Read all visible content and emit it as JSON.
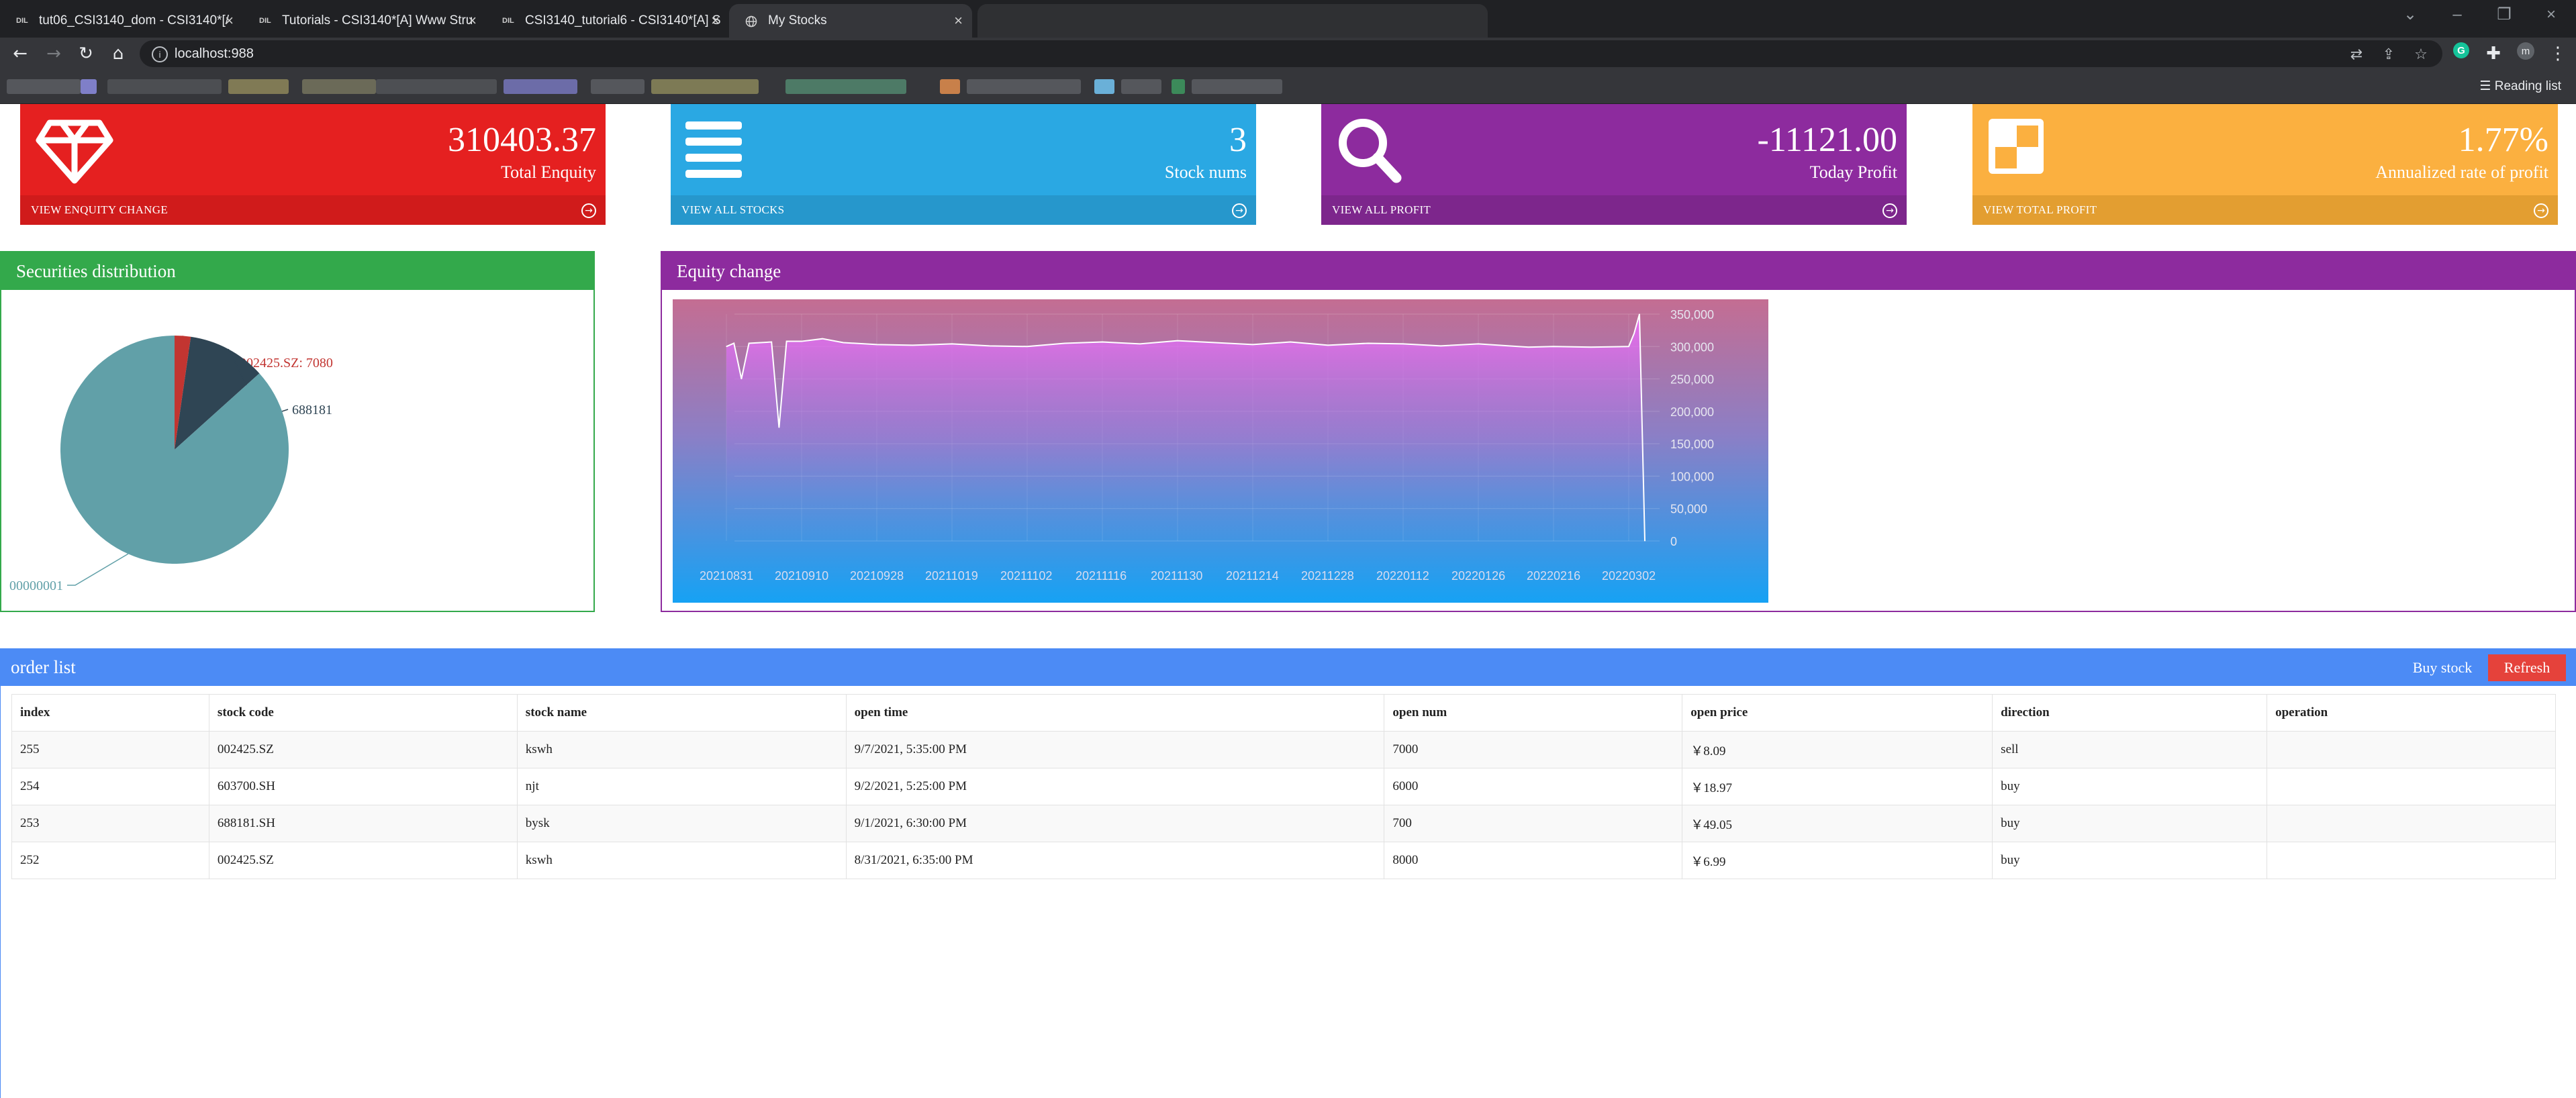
{
  "browser": {
    "tabs": [
      {
        "favicon": "DIL",
        "title": "tut06_CSI3140_dom - CSI3140*[/"
      },
      {
        "favicon": "DIL",
        "title": "Tutorials - CSI3140*[A] Www Stru"
      },
      {
        "favicon": "DIL",
        "title": "CSI3140_tutorial6 - CSI3140*[A] S"
      },
      {
        "favicon": "globe-icon",
        "title": "My Stocks"
      }
    ],
    "url": "localhost:988",
    "reading_list": "Reading list",
    "profile_initial": "m"
  },
  "cards": [
    {
      "value": "310403.37",
      "label": "Total Enquity",
      "footer": "VIEW ENQUITY CHANGE",
      "color": "#e52020",
      "footer_color": "#d01b1b",
      "icon": "diamond-icon"
    },
    {
      "value": "3",
      "label": "Stock nums",
      "footer": "VIEW ALL STOCKS",
      "color": "#2aa8e3",
      "footer_color": "#2697cc",
      "icon": "list-icon"
    },
    {
      "value": "-11121.00",
      "label": "Today Profit",
      "footer": "VIEW ALL PROFIT",
      "color": "#8d2b9e",
      "footer_color": "#7d268c",
      "icon": "search-icon"
    },
    {
      "value": "1.77%",
      "label": "Annualized rate of profit",
      "footer": "VIEW TOTAL PROFIT",
      "color": "#fbb040",
      "footer_color": "#e39e31",
      "icon": "pie-square-icon"
    }
  ],
  "distribution": {
    "title": "Securities distribution",
    "color": "#33a94b"
  },
  "equity": {
    "title": "Equity change",
    "color": "#8d2b9e"
  },
  "chart_data": [
    {
      "type": "pie",
      "title": "Securities distribution",
      "slices": [
        {
          "label": "002425.SZ: 7080",
          "value": 7080,
          "color": "#c23531"
        },
        {
          "label": "688181",
          "value": 34335,
          "color": "#2f4554"
        },
        {
          "label": "00000001",
          "value": 269000,
          "color": "#61a0a8"
        }
      ]
    },
    {
      "type": "area",
      "title": "Equity change",
      "x_ticks": [
        "20210831",
        "20210910",
        "20210928",
        "20211019",
        "20211102",
        "20211116",
        "20211130",
        "20211214",
        "20211228",
        "20220112",
        "20220126",
        "20220216",
        "20220302"
      ],
      "y_ticks": [
        "350,000",
        "300,000",
        "250,000",
        "200,000",
        "150,000",
        "100,000",
        "50,000",
        "0"
      ],
      "ylim": [
        0,
        350000
      ],
      "y_axis_side": "right",
      "grid": true,
      "series": [
        {
          "points": [
            [
              "20210831",
              300000
            ],
            [
              "20210901",
              305000
            ],
            [
              "20210902",
              250000
            ],
            [
              "20210903",
              305000
            ],
            [
              "20210906",
              307000
            ],
            [
              "20210907",
              175000
            ],
            [
              "20210908",
              308000
            ],
            [
              "20210910",
              308000
            ],
            [
              "20210915",
              312000
            ],
            [
              "20210920",
              306000
            ],
            [
              "20210928",
              303000
            ],
            [
              "20211008",
              302000
            ],
            [
              "20211019",
              304000
            ],
            [
              "20211026",
              301000
            ],
            [
              "20211102",
              300000
            ],
            [
              "20211109",
              305000
            ],
            [
              "20211116",
              307000
            ],
            [
              "20211123",
              304000
            ],
            [
              "20211130",
              309000
            ],
            [
              "20211207",
              306000
            ],
            [
              "20211214",
              303000
            ],
            [
              "20211221",
              307000
            ],
            [
              "20211228",
              302000
            ],
            [
              "20220105",
              305000
            ],
            [
              "20220112",
              304000
            ],
            [
              "20220119",
              301000
            ],
            [
              "20220126",
              304000
            ],
            [
              "20220209",
              299000
            ],
            [
              "20220216",
              300000
            ],
            [
              "20220223",
              299000
            ],
            [
              "20220302",
              300000
            ],
            [
              "20220303",
              320000
            ],
            [
              "20220304",
              350000
            ],
            [
              "20220305",
              0
            ]
          ]
        }
      ]
    }
  ],
  "orders": {
    "title": "order list",
    "buy_label": "Buy stock",
    "refresh_label": "Refresh",
    "columns": [
      "index",
      "stock code",
      "stock name",
      "open time",
      "open num",
      "open price",
      "direction",
      "operation"
    ],
    "rows": [
      [
        "255",
        "002425.SZ",
        "kswh",
        "9/7/2021, 5:35:00 PM",
        "7000",
        "￥8.09",
        "sell",
        ""
      ],
      [
        "254",
        "603700.SH",
        "njt",
        "9/2/2021, 5:25:00 PM",
        "6000",
        "￥18.97",
        "buy",
        ""
      ],
      [
        "253",
        "688181.SH",
        "bysk",
        "9/1/2021, 6:30:00 PM",
        "700",
        "￥49.05",
        "buy",
        ""
      ],
      [
        "252",
        "002425.SZ",
        "kswh",
        "8/31/2021, 6:35:00 PM",
        "8000",
        "￥6.99",
        "buy",
        ""
      ]
    ]
  }
}
